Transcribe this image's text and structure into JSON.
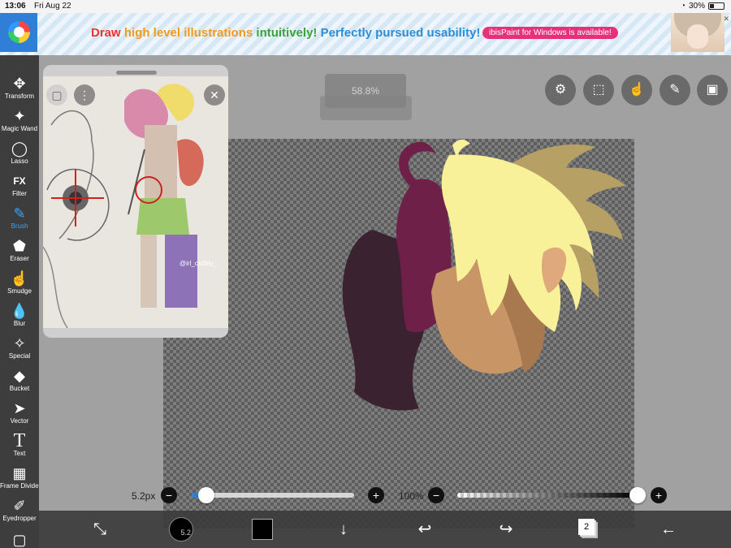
{
  "status_bar": {
    "time": "13:06",
    "date": "Fri Aug 22",
    "battery_percent": "30%",
    "battery_level": 0.3
  },
  "ad": {
    "words": [
      "Draw",
      "high level illustrations",
      "intuitively!",
      "Perfectly pursued usability!"
    ],
    "pill": "ibisPaint for Windows is available!"
  },
  "tools": [
    {
      "id": "transform",
      "label": "Transform",
      "icon": "✥"
    },
    {
      "id": "magic-wand",
      "label": "Magic Wand",
      "icon": "✦"
    },
    {
      "id": "lasso",
      "label": "Lasso",
      "icon": "◯"
    },
    {
      "id": "filter",
      "label": "Filter",
      "icon": "FX"
    },
    {
      "id": "brush",
      "label": "Brush",
      "icon": "✎",
      "active": true
    },
    {
      "id": "eraser",
      "label": "Eraser",
      "icon": "⬟"
    },
    {
      "id": "smudge",
      "label": "Smudge",
      "icon": "☝"
    },
    {
      "id": "blur",
      "label": "Blur",
      "icon": "💧"
    },
    {
      "id": "special",
      "label": "Special",
      "icon": "✧"
    },
    {
      "id": "bucket",
      "label": "Bucket",
      "icon": "◆"
    },
    {
      "id": "vector",
      "label": "Vector",
      "icon": "➤"
    },
    {
      "id": "text",
      "label": "Text",
      "icon": "T"
    },
    {
      "id": "frame-divider",
      "label": "Frame Divider",
      "icon": "▦"
    },
    {
      "id": "eyedropper",
      "label": "Eyedropper",
      "icon": "✐"
    }
  ],
  "canvas": {
    "zoom_display": "58.8%"
  },
  "reference": {
    "watermark": "@irl_catbily_"
  },
  "brush": {
    "size_label": "5.2px",
    "size_value": 5.2,
    "size_slider_fraction": 0.09,
    "opacity_label": "100%",
    "opacity_fraction": 1.0,
    "color": "#000000",
    "preview_label": "5.2"
  },
  "bottom": {
    "layer_count": "2"
  },
  "colors": {
    "accent": "#3ba4f7",
    "toolbar_bg": "#3d3d3d"
  }
}
